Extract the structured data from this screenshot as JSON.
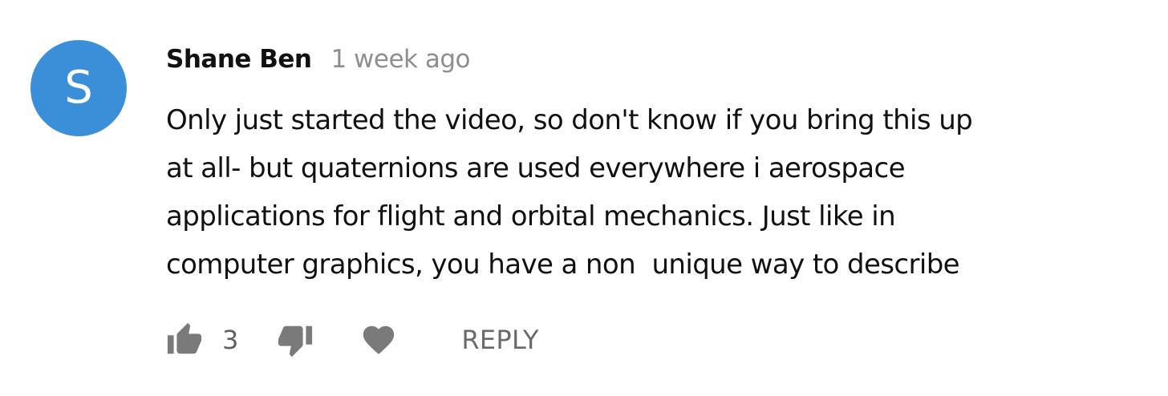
{
  "comment": {
    "avatar": {
      "initial": "S",
      "color": "#3b8fd9"
    },
    "author": "Shane Ben",
    "timestamp": "1 week ago",
    "text_lines": [
      "Only just started the video, so don't know if you bring this up",
      "at all- but quaternions are used everywhere i aerospace",
      "applications for flight and orbital mechanics. Just like in",
      "computer graphics, you have a non  unique way to describe"
    ],
    "actions": {
      "like_icon": "thumbs-up-icon",
      "like_count": "3",
      "dislike_icon": "thumbs-down-icon",
      "heart_icon": "heart-icon",
      "reply_label": "REPLY",
      "icon_color": "#7a7a7a"
    }
  }
}
